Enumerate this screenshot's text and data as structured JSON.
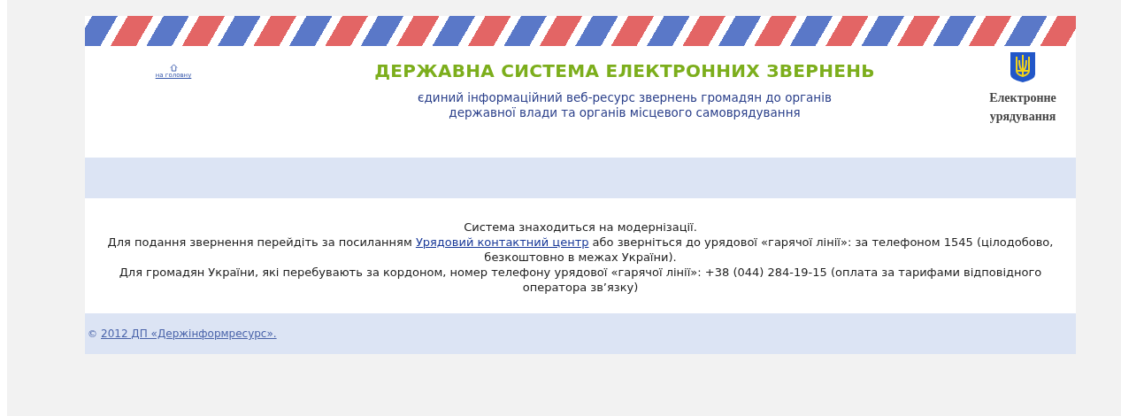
{
  "header": {
    "home_link": "на головну",
    "title": "ДЕРЖАВНА СИСТЕМА ЕЛЕКТРОННИХ ЗВЕРНЕНЬ",
    "subtitle_lines": [
      "єдиний інформаційний веб-ресурс звернень громадян до органів",
      "державної влади та органів місцевого самоврядування"
    ],
    "emblem_caption_lines": [
      "Електронне",
      "урядування"
    ]
  },
  "notice": {
    "status": "Система знаходиться на модернізації.",
    "contact_before": "Для подання звернення перейдіть за посиланням",
    "contact_link": "Урядовий контактний центр",
    "contact_after": "або зверніться до урядової «гарячої лінії»: за телефоном 1545 (цілодобово, безкоштовно в межах України).",
    "abroad": "Для громадян України, які перебувають за кордоном, номер телефону урядової «гарячої лінії»: +38 (044) 284-19-15 (оплата за тарифами відповідного оператора зв’язку)"
  },
  "footer": {
    "copyright_sign": "©",
    "link": "2012 ДП «Держінформресурс»."
  }
}
